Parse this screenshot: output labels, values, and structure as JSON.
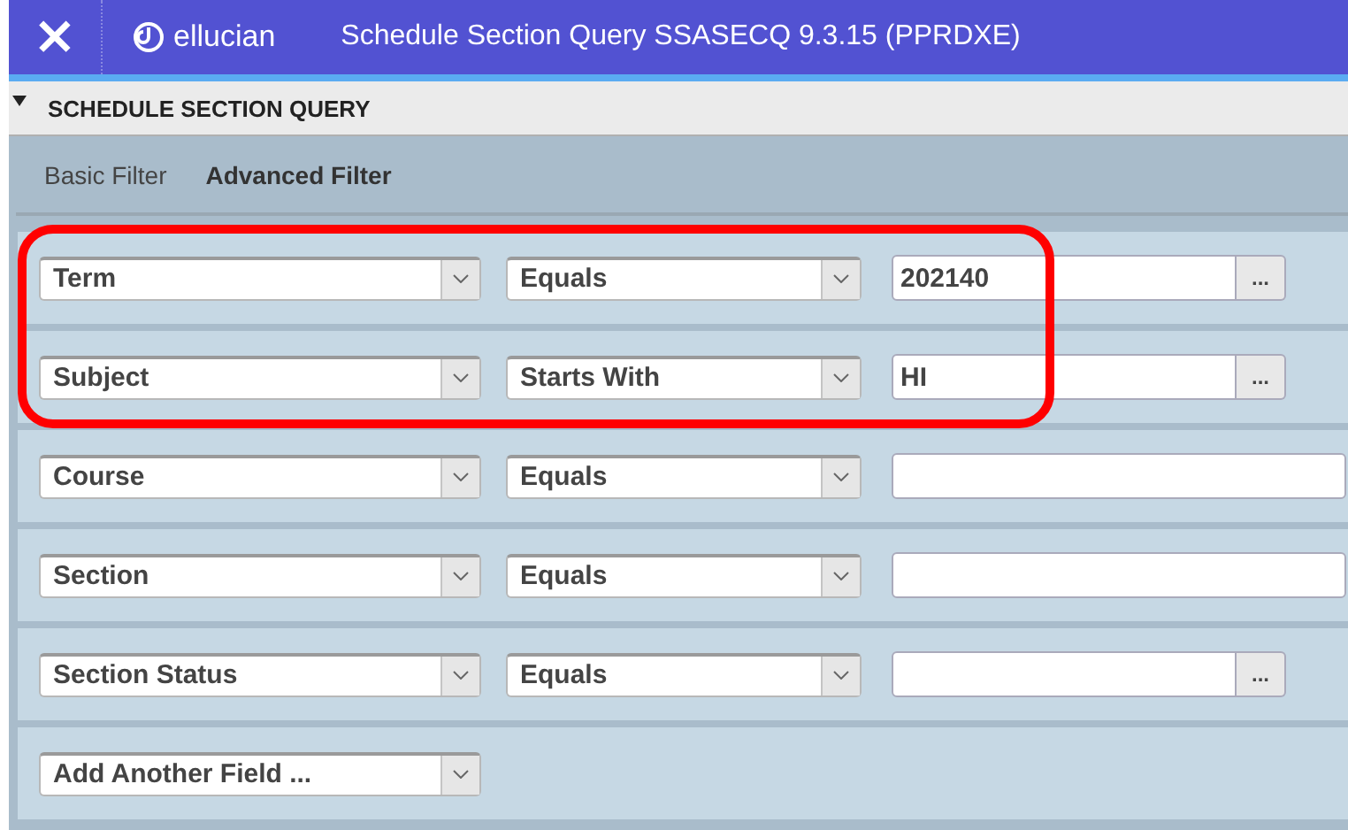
{
  "header": {
    "close": "×",
    "brand": "ellucian",
    "title": "Schedule Section Query SSASECQ 9.3.15 (PPRDXE)"
  },
  "section": {
    "title": "SCHEDULE SECTION QUERY",
    "expanded": true
  },
  "tabs": [
    {
      "label": "Basic Filter",
      "selected": false
    },
    {
      "label": "Advanced Filter",
      "selected": true
    }
  ],
  "rows": [
    {
      "kind": "criterion",
      "field": "Term",
      "operator": "Equals",
      "value": "202140",
      "lookup": true,
      "highlighted": true
    },
    {
      "kind": "criterion",
      "field": "Subject",
      "operator": "Starts With",
      "value": "HI",
      "lookup": true,
      "highlighted": true
    },
    {
      "kind": "criterion",
      "field": "Course",
      "operator": "Equals",
      "lookup": false,
      "highlighted": false
    },
    {
      "kind": "criterion",
      "field": "Section",
      "operator": "Equals",
      "lookup": false,
      "highlighted": false
    },
    {
      "kind": "criterion",
      "field": "Section Status",
      "operator": "Equals",
      "lookup": true,
      "highlighted": false
    },
    {
      "kind": "add",
      "field": "Add Another Field ...",
      "highlighted": false
    }
  ],
  "lookup_label": "..."
}
